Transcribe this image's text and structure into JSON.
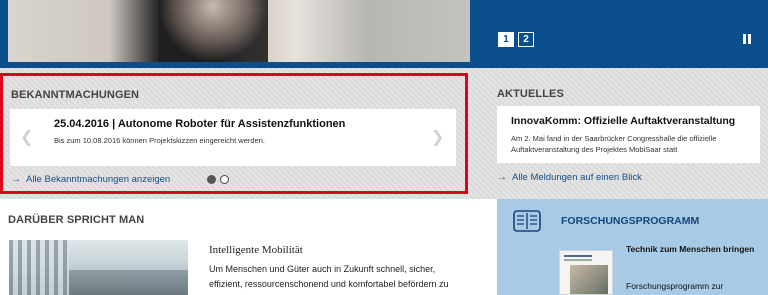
{
  "hero": {
    "pages": [
      "1",
      "2"
    ],
    "active_page": "1"
  },
  "bekanntmachungen": {
    "title": "BEKANNTMACHUNGEN",
    "headline": "25.04.2016 |  Autonome Roboter für Assistenzfunktionen",
    "subtext": "Bis zum 10.08.2016 können Projektskizzen eingereicht werden.",
    "link_label": "Alle Bekanntmachungen anzeigen",
    "slides_total": 2,
    "active_slide": 1,
    "highlight_color": "#e3001b"
  },
  "aktuelles": {
    "title": "AKTUELLES",
    "headline": "InnovaKomm: Offizielle Auftaktveranstaltung",
    "subtext": "Am 2. Mai fand in der Saarbrücker Congresshalle die offizielle Auftaktveranstaltung des Projektes MobiSaar statt",
    "link_label": "Alle Meldungen auf einen Blick"
  },
  "daruber": {
    "title": "DARÜBER SPRICHT MAN",
    "article_title": "Intelligente Mobilität",
    "article_text": "Um Menschen und Güter auch in Zukunft schnell, sicher, effizient, ressourcenschonend und komfortabel befördern zu"
  },
  "forschung": {
    "title": "FORSCHUNGSPROGRAMM",
    "text_bold": "Technik zum Menschen bringen",
    "text": "Forschungsprogramm zur",
    "icon": "book-icon",
    "bg_color": "#a7cbe6"
  },
  "colors": {
    "brand_blue": "#0b4f8c",
    "link_blue": "#1b4f88"
  }
}
